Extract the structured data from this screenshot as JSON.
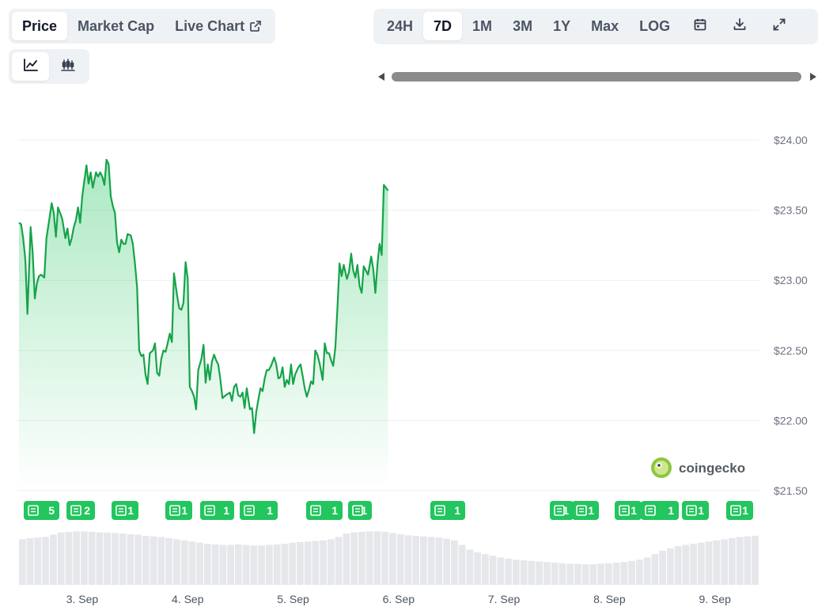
{
  "tabs_left": [
    {
      "label": "Price",
      "active": true
    },
    {
      "label": "Market Cap",
      "active": false
    },
    {
      "label": "Live Chart",
      "active": false
    }
  ],
  "style_tabs": [
    {
      "icon": "line-chart-icon",
      "active": true
    },
    {
      "icon": "candlestick-icon",
      "active": false
    }
  ],
  "range_tabs": [
    {
      "label": "24H",
      "active": false
    },
    {
      "label": "7D",
      "active": true
    },
    {
      "label": "1M",
      "active": false
    },
    {
      "label": "3M",
      "active": false
    },
    {
      "label": "1Y",
      "active": false
    },
    {
      "label": "Max",
      "active": false
    },
    {
      "label": "LOG",
      "active": false
    }
  ],
  "range_icons": [
    "calendar-icon",
    "download-icon",
    "fullscreen-icon"
  ],
  "brand": "coingecko",
  "colors": {
    "line": "#16a34a",
    "badge": "#22c55e",
    "volume": "#e5e7eb",
    "grid": "#eceff1"
  },
  "chart_data": {
    "type": "line",
    "y_tick_labels": [
      "$24.00",
      "$23.50",
      "$23.00",
      "$22.50",
      "$22.00",
      "$21.50"
    ],
    "y_ticks": [
      24.0,
      23.5,
      23.0,
      22.5,
      22.0,
      21.5
    ],
    "ylim": [
      21.5,
      24.0
    ],
    "x_tick_labels": [
      "3. Sep",
      "4. Sep",
      "5. Sep",
      "6. Sep",
      "7. Sep",
      "8. Sep",
      "9. Sep"
    ],
    "x_range_days": [
      2.4,
      9.4
    ],
    "series": [
      {
        "type": "line",
        "points": [
          [
            2.4,
            23.41
          ],
          [
            2.42,
            23.4
          ],
          [
            2.44,
            23.3
          ],
          [
            2.46,
            23.15
          ],
          [
            2.48,
            22.76
          ],
          [
            2.51,
            23.38
          ],
          [
            2.53,
            23.2
          ],
          [
            2.55,
            22.87
          ],
          [
            2.57,
            22.98
          ],
          [
            2.59,
            23.03
          ],
          [
            2.61,
            23.04
          ],
          [
            2.64,
            23.02
          ],
          [
            2.66,
            23.3
          ],
          [
            2.69,
            23.45
          ],
          [
            2.71,
            23.55
          ],
          [
            2.73,
            23.48
          ],
          [
            2.75,
            23.31
          ],
          [
            2.77,
            23.52
          ],
          [
            2.79,
            23.48
          ],
          [
            2.81,
            23.44
          ],
          [
            2.84,
            23.3
          ],
          [
            2.86,
            23.37
          ],
          [
            2.88,
            23.25
          ],
          [
            2.9,
            23.3
          ],
          [
            2.92,
            23.38
          ],
          [
            2.94,
            23.43
          ],
          [
            2.96,
            23.52
          ],
          [
            2.98,
            23.41
          ],
          [
            3.0,
            23.6
          ],
          [
            3.02,
            23.71
          ],
          [
            3.04,
            23.82
          ],
          [
            3.06,
            23.69
          ],
          [
            3.08,
            23.77
          ],
          [
            3.1,
            23.66
          ],
          [
            3.13,
            23.77
          ],
          [
            3.15,
            23.74
          ],
          [
            3.17,
            23.77
          ],
          [
            3.19,
            23.74
          ],
          [
            3.21,
            23.68
          ],
          [
            3.23,
            23.86
          ],
          [
            3.25,
            23.83
          ],
          [
            3.27,
            23.6
          ],
          [
            3.29,
            23.53
          ],
          [
            3.31,
            23.48
          ],
          [
            3.33,
            23.27
          ],
          [
            3.35,
            23.2
          ],
          [
            3.37,
            23.29
          ],
          [
            3.39,
            23.26
          ],
          [
            3.41,
            23.26
          ],
          [
            3.43,
            23.33
          ],
          [
            3.46,
            23.32
          ],
          [
            3.48,
            23.26
          ],
          [
            3.5,
            23.12
          ],
          [
            3.52,
            22.95
          ],
          [
            3.54,
            22.5
          ],
          [
            3.56,
            22.46
          ],
          [
            3.58,
            22.47
          ],
          [
            3.6,
            22.33
          ],
          [
            3.62,
            22.26
          ],
          [
            3.64,
            22.48
          ],
          [
            3.67,
            22.5
          ],
          [
            3.69,
            22.55
          ],
          [
            3.71,
            22.34
          ],
          [
            3.73,
            22.32
          ],
          [
            3.75,
            22.44
          ],
          [
            3.77,
            22.5
          ],
          [
            3.79,
            22.49
          ],
          [
            3.81,
            22.55
          ],
          [
            3.83,
            22.62
          ],
          [
            3.85,
            22.56
          ],
          [
            3.87,
            23.05
          ],
          [
            3.9,
            22.89
          ],
          [
            3.92,
            22.8
          ],
          [
            3.94,
            22.79
          ],
          [
            3.96,
            22.84
          ],
          [
            3.98,
            23.13
          ],
          [
            4.0,
            23.01
          ],
          [
            4.02,
            22.24
          ],
          [
            4.04,
            22.21
          ],
          [
            4.06,
            22.17
          ],
          [
            4.08,
            22.08
          ],
          [
            4.1,
            22.36
          ],
          [
            4.13,
            22.44
          ],
          [
            4.15,
            22.54
          ],
          [
            4.17,
            22.27
          ],
          [
            4.19,
            22.4
          ],
          [
            4.21,
            22.29
          ],
          [
            4.23,
            22.42
          ],
          [
            4.25,
            22.47
          ],
          [
            4.27,
            22.43
          ],
          [
            4.29,
            22.4
          ],
          [
            4.31,
            22.29
          ],
          [
            4.33,
            22.16
          ],
          [
            4.36,
            22.18
          ],
          [
            4.38,
            22.19
          ],
          [
            4.4,
            22.2
          ],
          [
            4.42,
            22.14
          ],
          [
            4.44,
            22.24
          ],
          [
            4.46,
            22.26
          ],
          [
            4.48,
            22.18
          ],
          [
            4.5,
            22.17
          ],
          [
            4.52,
            22.2
          ],
          [
            4.54,
            22.09
          ],
          [
            4.56,
            22.23
          ],
          [
            4.59,
            22.08
          ],
          [
            4.61,
            22.09
          ],
          [
            4.63,
            21.91
          ],
          [
            4.65,
            22.06
          ],
          [
            4.67,
            22.15
          ],
          [
            4.69,
            22.23
          ],
          [
            4.71,
            22.21
          ],
          [
            4.73,
            22.3
          ],
          [
            4.75,
            22.36
          ],
          [
            4.77,
            22.36
          ],
          [
            4.79,
            22.39
          ],
          [
            4.82,
            22.45
          ],
          [
            4.84,
            22.4
          ],
          [
            4.86,
            22.3
          ],
          [
            4.88,
            22.31
          ],
          [
            4.9,
            22.38
          ],
          [
            4.92,
            22.24
          ],
          [
            4.94,
            22.29
          ],
          [
            4.96,
            22.26
          ],
          [
            4.98,
            22.4
          ],
          [
            5.0,
            22.26
          ],
          [
            5.02,
            22.33
          ],
          [
            5.05,
            22.38
          ],
          [
            5.07,
            22.4
          ],
          [
            5.09,
            22.32
          ],
          [
            5.11,
            22.23
          ],
          [
            5.13,
            22.17
          ],
          [
            5.15,
            22.22
          ],
          [
            5.17,
            22.28
          ],
          [
            5.19,
            22.26
          ],
          [
            5.21,
            22.5
          ],
          [
            5.23,
            22.47
          ],
          [
            5.25,
            22.41
          ],
          [
            5.28,
            22.29
          ],
          [
            5.3,
            22.55
          ],
          [
            5.32,
            22.48
          ],
          [
            5.34,
            22.48
          ],
          [
            5.36,
            22.43
          ],
          [
            5.38,
            22.39
          ],
          [
            5.4,
            22.52
          ],
          [
            5.42,
            22.8
          ],
          [
            5.44,
            23.12
          ],
          [
            5.46,
            23.03
          ],
          [
            5.48,
            23.11
          ],
          [
            5.51,
            23.01
          ],
          [
            5.53,
            23.06
          ],
          [
            5.55,
            23.19
          ],
          [
            5.57,
            23.07
          ],
          [
            5.59,
            23.02
          ],
          [
            5.61,
            23.11
          ],
          [
            5.63,
            22.96
          ],
          [
            5.65,
            22.91
          ],
          [
            5.67,
            23.1
          ],
          [
            5.69,
            23.07
          ],
          [
            5.71,
            23.04
          ],
          [
            5.74,
            23.17
          ],
          [
            5.76,
            23.08
          ],
          [
            5.78,
            22.91
          ],
          [
            5.8,
            23.12
          ],
          [
            5.82,
            23.26
          ],
          [
            5.84,
            23.18
          ],
          [
            5.86,
            23.68
          ],
          [
            5.88,
            23.66
          ],
          [
            5.9,
            23.64
          ]
        ]
      }
    ],
    "news_badges": [
      {
        "label": "5",
        "count": 5
      },
      {
        "label": "2",
        "count": 2
      },
      {
        "label": "1",
        "count": 1
      },
      {
        "label": "1",
        "count": 1
      },
      {
        "label": "1",
        "count": 1
      },
      {
        "label": "1",
        "count": 1
      },
      {
        "label": "1",
        "count": 1
      },
      {
        "label": "1",
        "count": 1
      },
      {
        "label": "1",
        "count": 1
      },
      {
        "label": "1",
        "count": 1
      },
      {
        "label": "1",
        "count": 1
      },
      {
        "label": "1",
        "count": 1
      },
      {
        "label": "1",
        "count": 1
      },
      {
        "label": "1",
        "count": 1
      },
      {
        "label": "1",
        "count": 1
      }
    ],
    "volume_levels": [
      0.8,
      0.82,
      0.83,
      0.84,
      0.88,
      0.92,
      0.93,
      0.94,
      0.94,
      0.93,
      0.92,
      0.92,
      0.91,
      0.9,
      0.89,
      0.88,
      0.86,
      0.85,
      0.84,
      0.82,
      0.8,
      0.78,
      0.76,
      0.74,
      0.72,
      0.71,
      0.7,
      0.7,
      0.71,
      0.7,
      0.69,
      0.69,
      0.7,
      0.71,
      0.72,
      0.74,
      0.75,
      0.76,
      0.77,
      0.78,
      0.8,
      0.84,
      0.9,
      0.92,
      0.93,
      0.94,
      0.94,
      0.93,
      0.91,
      0.89,
      0.87,
      0.86,
      0.85,
      0.84,
      0.83,
      0.81,
      0.78,
      0.7,
      0.62,
      0.57,
      0.54,
      0.51,
      0.48,
      0.46,
      0.44,
      0.43,
      0.42,
      0.41,
      0.4,
      0.39,
      0.38,
      0.37,
      0.37,
      0.36,
      0.36,
      0.37,
      0.38,
      0.39,
      0.4,
      0.42,
      0.44,
      0.48,
      0.54,
      0.6,
      0.64,
      0.68,
      0.7,
      0.72,
      0.74,
      0.76,
      0.78,
      0.8,
      0.82,
      0.84,
      0.85,
      0.86
    ]
  }
}
